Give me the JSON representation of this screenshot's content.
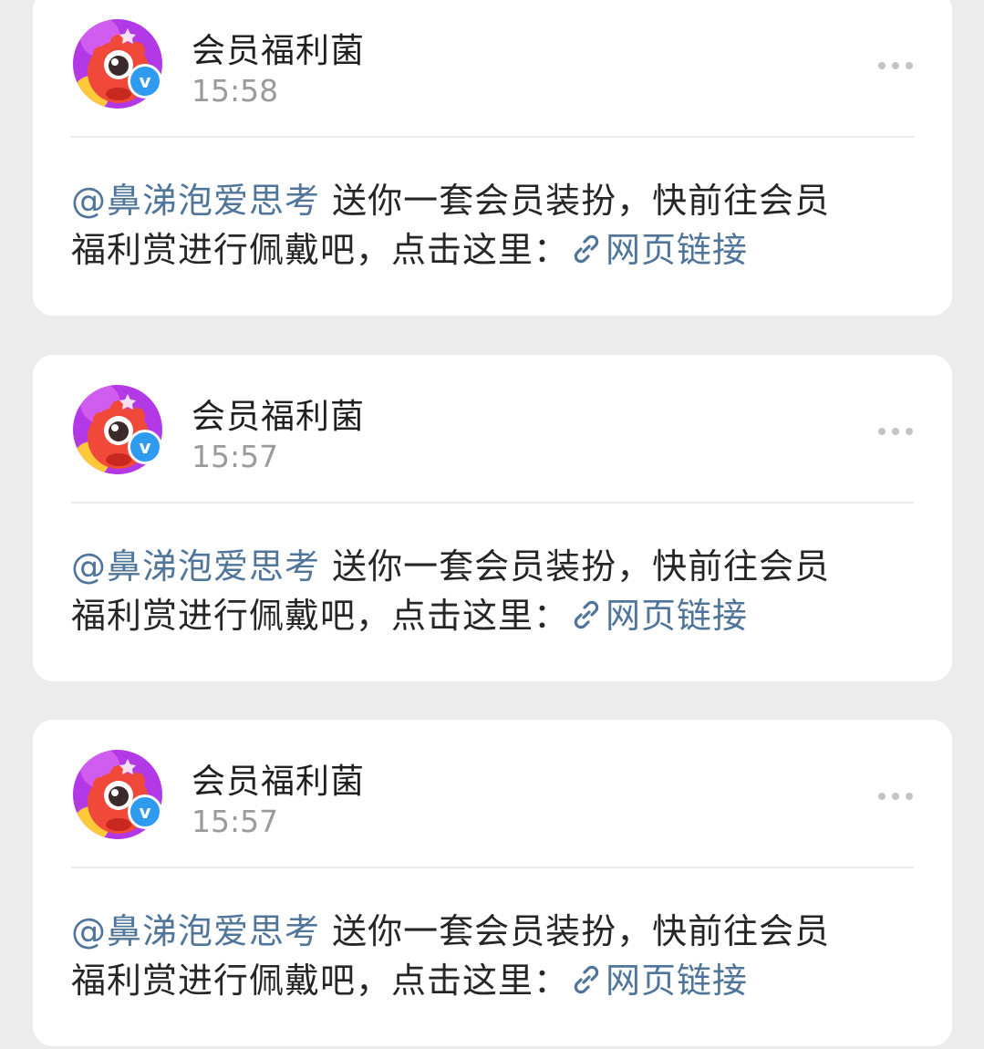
{
  "posts": [
    {
      "author": "会员福利菌",
      "time": "15:58",
      "mention": "@鼻涕泡爱思考",
      "text_line1": " 送你一套会员装扮，快前往会员",
      "text_line2": "福利赏进行佩戴吧，点击这里：",
      "link_label": "网页链接",
      "verified_mark": "v"
    },
    {
      "author": "会员福利菌",
      "time": "15:57",
      "mention": "@鼻涕泡爱思考",
      "text_line1": " 送你一套会员装扮，快前往会员",
      "text_line2": "福利赏进行佩戴吧，点击这里：",
      "link_label": "网页链接",
      "verified_mark": "v"
    },
    {
      "author": "会员福利菌",
      "time": "15:57",
      "mention": "@鼻涕泡爱思考",
      "text_line1": " 送你一套会员装扮，快前往会员",
      "text_line2": "福利赏进行佩戴吧，点击这里：",
      "link_label": "网页链接",
      "verified_mark": "v"
    }
  ],
  "icons": {
    "avatar": "red-monster-mascot-avatar",
    "verified": "verified-badge-icon",
    "more": "more-options-icon",
    "link": "link-chain-icon"
  },
  "colors": {
    "background": "#ececec",
    "card": "#ffffff",
    "link": "#50759a",
    "verified_badge": "#2f9bf0",
    "time": "#9b9b9b"
  }
}
